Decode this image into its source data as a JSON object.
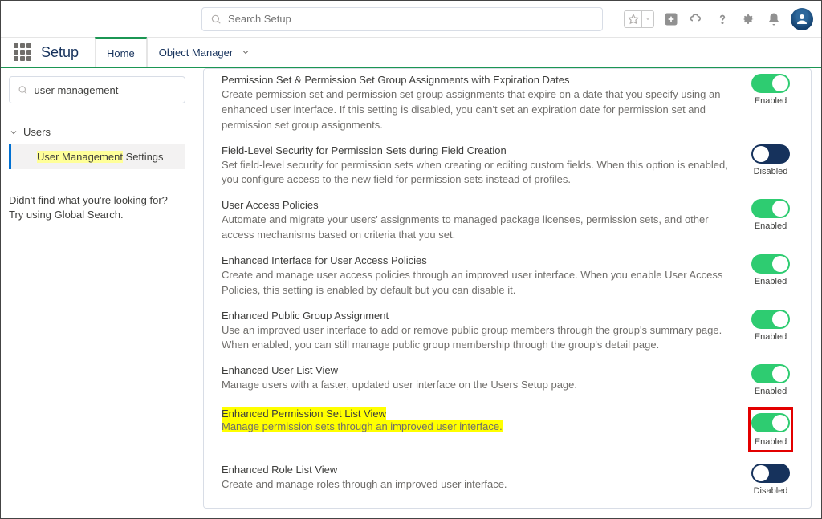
{
  "topbar": {
    "search_placeholder": "Search Setup"
  },
  "nav": {
    "app_name": "Setup",
    "tabs": [
      {
        "label": "Home"
      },
      {
        "label": "Object Manager"
      }
    ]
  },
  "sidebar": {
    "search_value": "user management",
    "tree_label": "Users",
    "selected_item_hl": "User Management",
    "selected_item_rest": " Settings",
    "help_line1": "Didn't find what you're looking for?",
    "help_line2": "Try using Global Search."
  },
  "toggle_states": {
    "enabled": "Enabled",
    "disabled": "Disabled"
  },
  "settings": [
    {
      "title": "Permission Set & Permission Set Group Assignments with Expiration Dates",
      "desc": "Create permission set and permission set group assignments that expire on a date that you specify using an enhanced user interface. If this setting is disabled, you can't set an expiration date for permission set and permission set group assignments.",
      "state": "enabled"
    },
    {
      "title": "Field-Level Security for Permission Sets during Field Creation",
      "desc": "Set field-level security for permission sets when creating or editing custom fields. When this option is enabled, you configure access to the new field for permission sets instead of profiles.",
      "state": "disabled"
    },
    {
      "title": "User Access Policies",
      "desc": "Automate and migrate your users' assignments to managed package licenses, permission sets, and other access mechanisms based on criteria that you set.",
      "state": "enabled"
    },
    {
      "title": "Enhanced Interface for User Access Policies",
      "desc": "Create and manage user access policies through an improved user interface. When you enable User Access Policies, this setting is enabled by default but you can disable it.",
      "state": "enabled"
    },
    {
      "title": "Enhanced Public Group Assignment",
      "desc": "Use an improved user interface to add or remove public group members through the group's summary page. When enabled, you can still manage public group membership through the group's detail page.",
      "state": "enabled"
    },
    {
      "title": "Enhanced User List View",
      "desc": "Manage users with a faster, updated user interface on the Users Setup page.",
      "state": "enabled"
    },
    {
      "title": "Enhanced Permission Set List View",
      "desc": "Manage permission sets through an improved user interface.",
      "state": "enabled",
      "highlighted": true,
      "redbox": true
    },
    {
      "title": "Enhanced Role List View",
      "desc": "Create and manage roles through an improved user interface.",
      "state": "disabled"
    }
  ]
}
